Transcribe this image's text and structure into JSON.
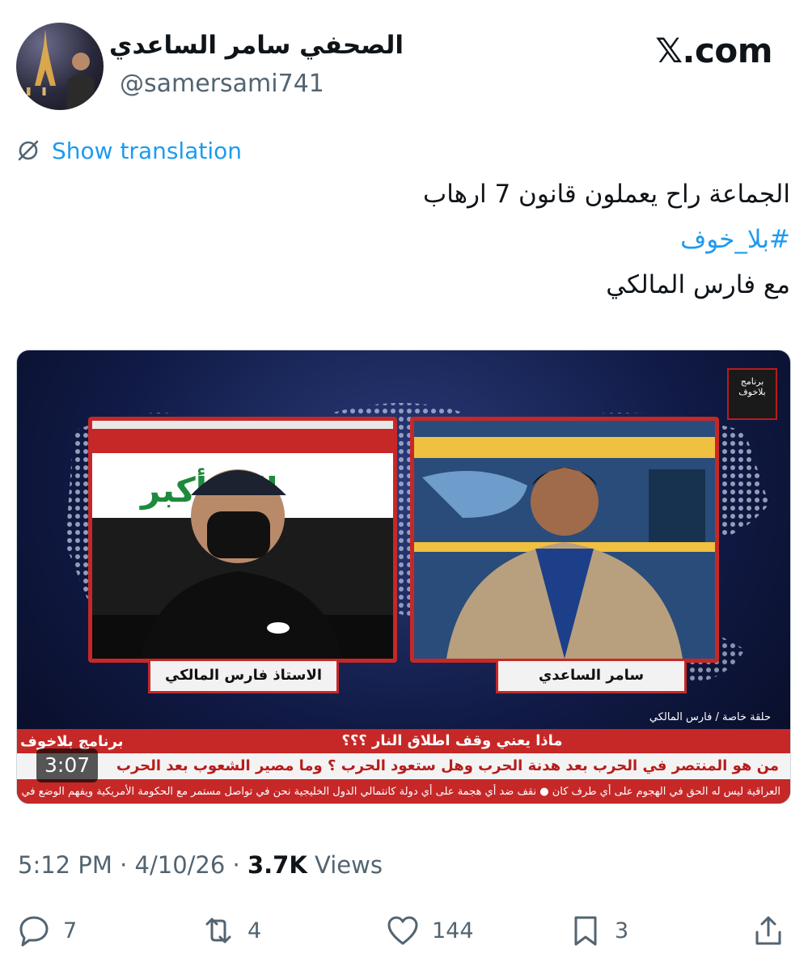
{
  "author": {
    "display_name": "الصحفي سامر الساعدي",
    "handle": "@samersami741",
    "avatar_icon": "avatar-photo"
  },
  "brand": {
    "site": "𝕏.com"
  },
  "translation": {
    "label": "Show translation",
    "icon": "globe-slash-icon"
  },
  "tweet": {
    "line1": "الجماعة  راح يعملون قانون 7 ارهاب",
    "hashtag": "#بلا_خوف",
    "line3": "مع فارس المالكي"
  },
  "video": {
    "duration": "3:07",
    "channel_logo": "برنامج بلاخوف",
    "name_left": "الاستاذ فارس المالكي",
    "name_right": "سامر الساعدي",
    "episode": "حلقة خاصة / فارس المالكي",
    "headline": "ماذا يعني وقف اطلاق النار ؟؟؟",
    "subheadline": "من هو المنتصر في الحرب بعد هدنة الحرب وهل ستعود الحرب  ؟ وما مصير الشعوب بعد الحرب",
    "crawl": "العراقية ليس له الحق في الهجوم على أي طرف كان  ● نقف ضد أي هجمة على أي دولة كانتمالي الدول الخليجية نحن في تواصل مستمر مع الحكومة الأمريكية ويفهم الوضع في",
    "show_logo": "برنامج بلاخوف"
  },
  "meta": {
    "time": "5:12 PM",
    "separator": "·",
    "date": "4/10/26",
    "views_count": "3.7K",
    "views_label": "Views"
  },
  "actions": {
    "replies": "7",
    "reposts": "4",
    "likes": "144",
    "bookmarks": "3"
  },
  "colors": {
    "accent": "#1d9bf0",
    "muted": "#536471",
    "text": "#0f1419",
    "tv_red": "#c62828"
  }
}
